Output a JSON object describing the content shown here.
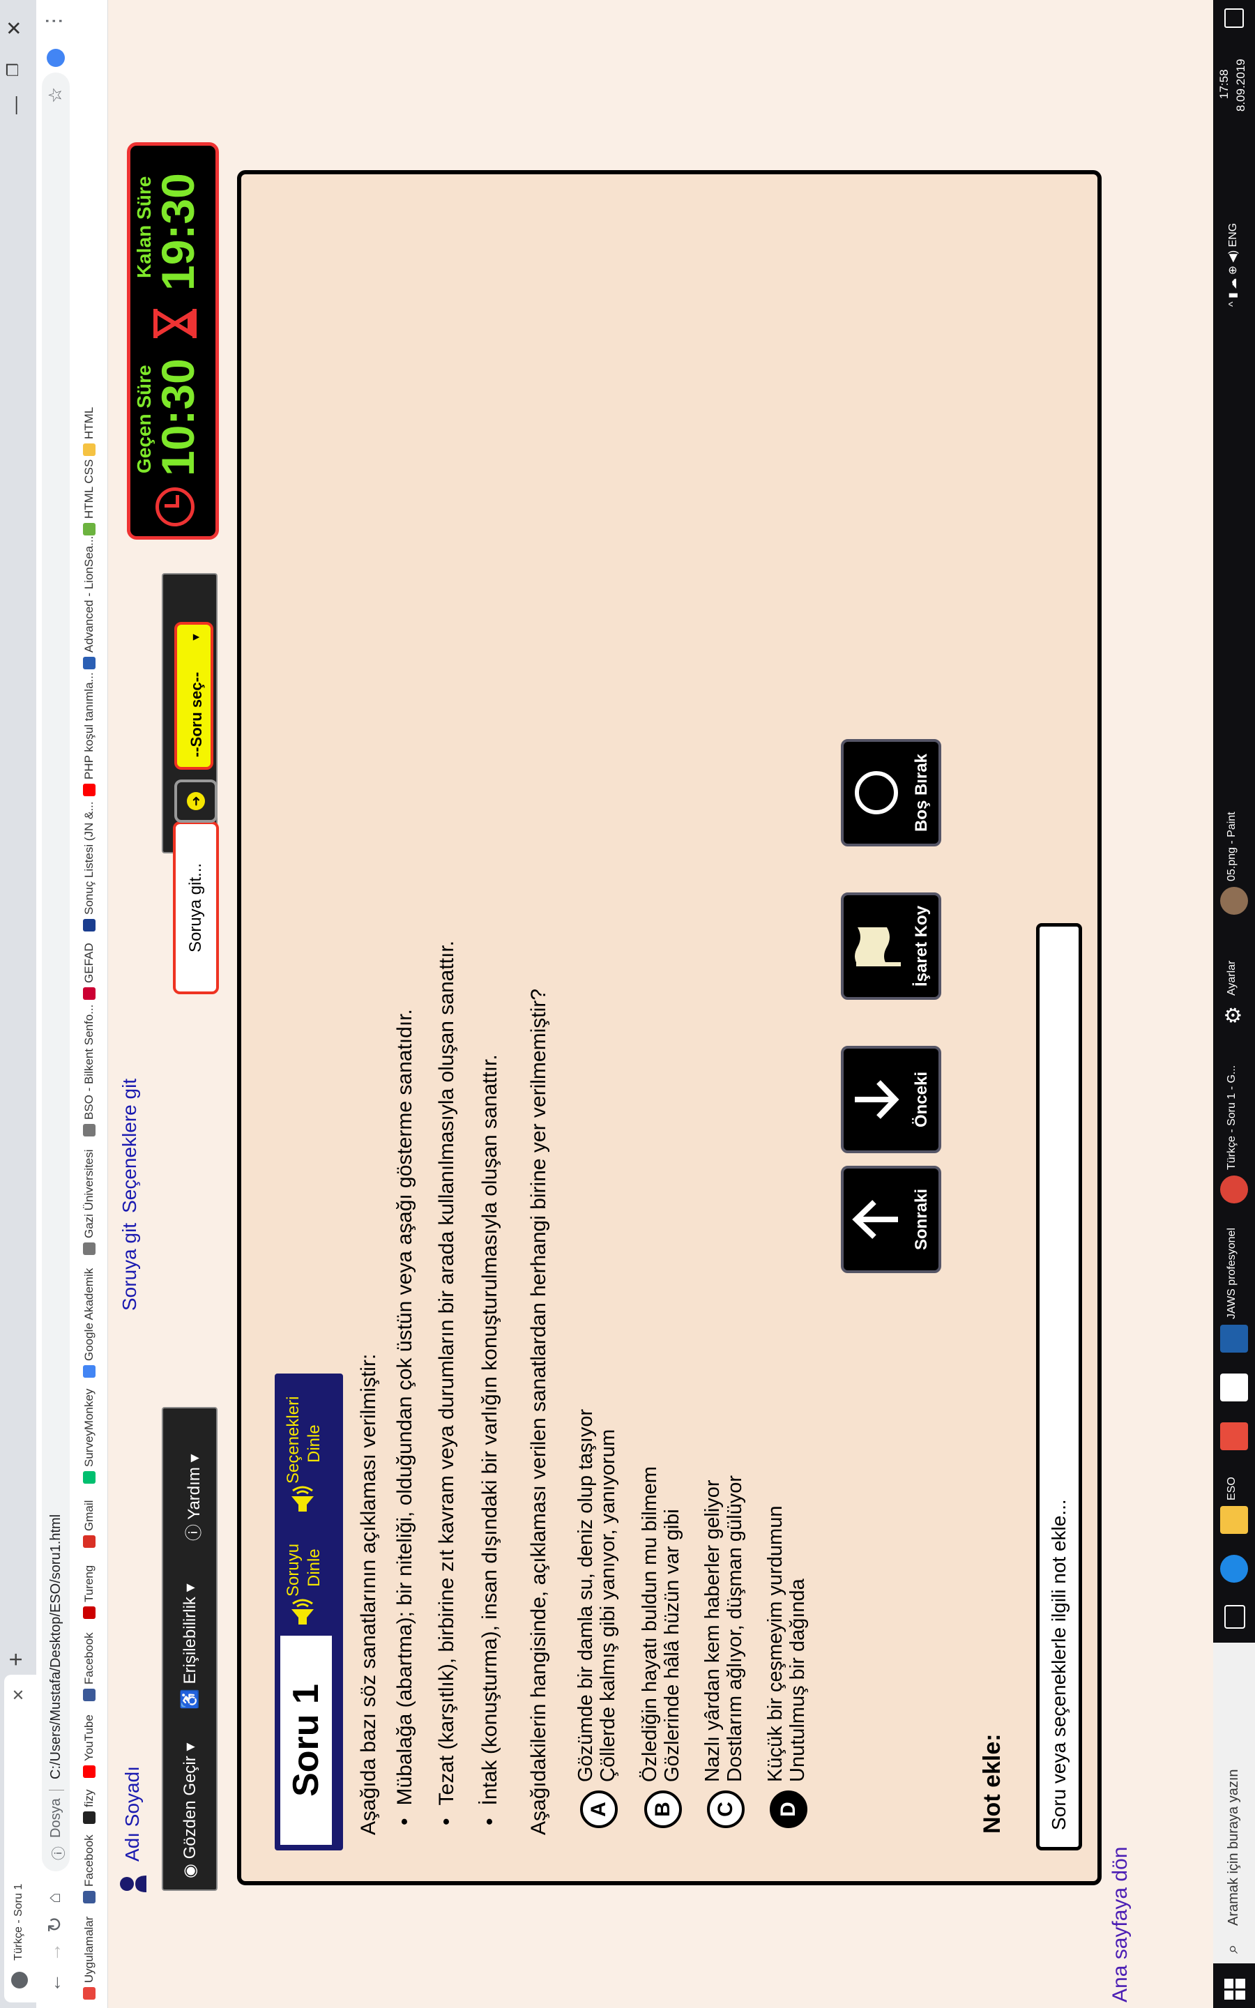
{
  "browser": {
    "tab_title": "Türkçe - Soru 1",
    "new_tab": "+",
    "omnibox_label": "Dosya",
    "url": "C:/Users/Mustafa/Desktop/ESO/soru1.html",
    "bookmarks": [
      "Uygulamalar",
      "Facebook",
      "fizy",
      "YouTube",
      "Facebook",
      "Tureng",
      "Gmail",
      "SurveyMonkey",
      "Google Akademik",
      "Gazi Üniversitesi",
      "BSO - Bilkent Senfo...",
      "GEFAD",
      "Sonuç Listesi (JN &...",
      "PHP koşul tanımla...",
      "Advanced - LionSea...",
      "HTML CSS",
      "HTML"
    ]
  },
  "page": {
    "user_name": "Adı Soyadı",
    "skip_to_question": "Soruya git",
    "skip_to_options": "Seçeneklere git",
    "menu": {
      "browse": "Gözden Geçir",
      "accessibility": "Erişilebilirlik",
      "help": "Yardım"
    },
    "goto_label": "Soruya git...",
    "select_label": "--Soru seç--",
    "timer": {
      "elapsed_label": "Geçen Süre",
      "elapsed": "10:30",
      "remaining_label": "Kalan Süre",
      "remaining": "19:30"
    },
    "question_title": "Soru 1",
    "listen_question": [
      "Soruyu",
      "Dinle"
    ],
    "listen_options": [
      "Seçenekleri",
      "Dinle"
    ],
    "stem": "Aşağıda bazı söz sanatlarının açıklaması verilmiştir:",
    "bullets": [
      "Mübalağa (abartma); bir niteliği, olduğundan çok üstün veya aşağı gösterme sanatıdır.",
      "Tezat (karşıtlık), birbirine zıt kavram veya durumların bir arada kullanılmasıyla oluşan sanattır.",
      "İntak (konuşturma), insan dışındaki bir varlığın konuşturulmasıyla oluşan sanattır."
    ],
    "question": "Aşağıdakilerin hangisinde, açıklaması verilen sanatlardan herhangi birine yer verilmemiştir?",
    "choices": [
      {
        "letter": "A",
        "line1": "Gözümde bir damla su, deniz olup taşıyor",
        "line2": "Çöllerde kalmış gibi yanıyor, yanıyorum"
      },
      {
        "letter": "B",
        "line1": "Özlediğin hayatı buldun mu bilmem",
        "line2": "Gözlerinde hâlâ hüzün var gibi"
      },
      {
        "letter": "C",
        "line1": "Nazlı yârdan kem haberler geliyor",
        "line2": "Dostlarım ağlıyor, düşman gülüyor"
      },
      {
        "letter": "D",
        "line1": "Küçük bir çeşmeyim yurdumun",
        "line2": "Unutulmuş bir dağında"
      }
    ],
    "nav": {
      "next": "Sonraki",
      "prev": "Önceki",
      "mark": "İşaret Koy",
      "skip": "Boş Bırak"
    },
    "note_label": "Not ekle:",
    "note_placeholder": "Soru veya seçeneklerle ilgili not ekle...",
    "home_link": "Ana sayfaya dön"
  },
  "taskbar": {
    "search_placeholder": "Aramak için buraya yazın",
    "apps": [
      "ESO",
      "JAWS profesyonel",
      "Türkçe - Soru 1 - G...",
      "Ayarlar",
      "05.png - Paint"
    ],
    "language": "ENG",
    "time": "17:58",
    "date": "8.09.2019"
  },
  "colors": {
    "panel_bg": "#f7e2cf",
    "timer_text": "#7fe82a",
    "accent_red": "#e33",
    "listen_yellow": "#f5e600",
    "header_blue": "#1a1a6e"
  }
}
